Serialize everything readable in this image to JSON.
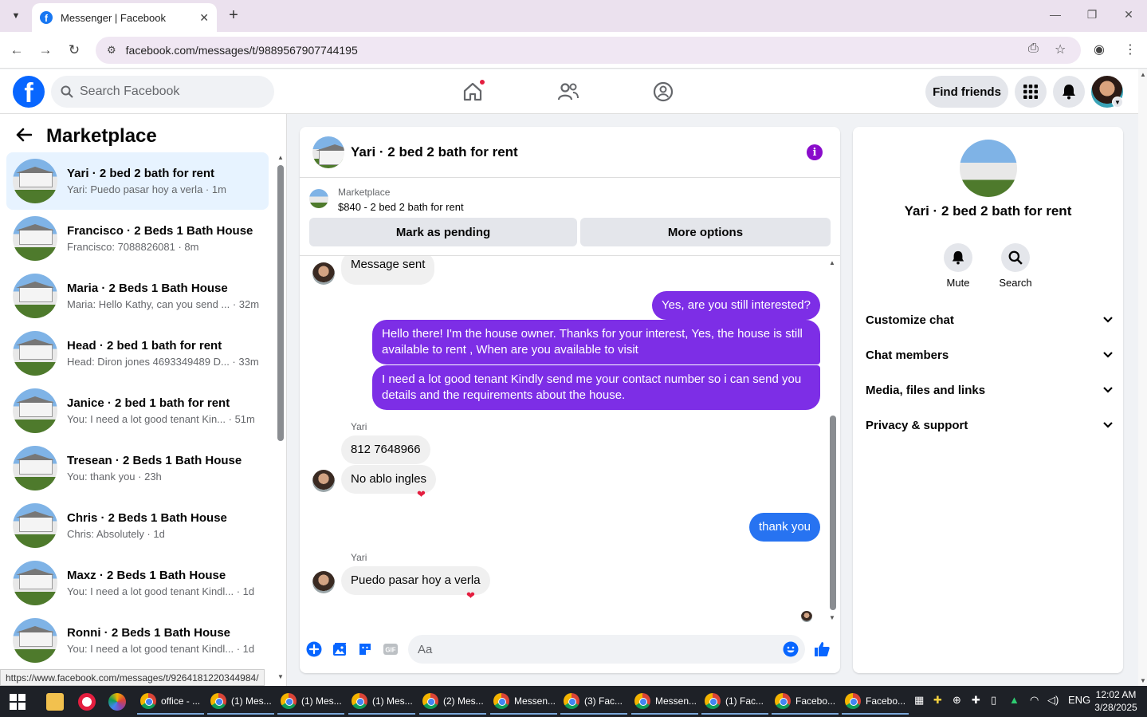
{
  "browser": {
    "tab_title": "Messenger | Facebook",
    "url": "facebook.com/messages/t/9889567907744195",
    "status_url": "https://www.facebook.com/messages/t/9264181220344984/"
  },
  "header": {
    "search_placeholder": "Search Facebook",
    "find_friends": "Find friends"
  },
  "sidebar": {
    "title": "Marketplace",
    "conversations": [
      {
        "name": "Yari · 2 bed 2 bath for rent",
        "preview": "Yari: Puedo pasar hoy a verla · 1m"
      },
      {
        "name": "Francisco · 2 Beds 1 Bath House",
        "preview": "Francisco: 7088826081 · 8m"
      },
      {
        "name": "Maria · 2 Beds 1 Bath House",
        "preview": "Maria: Hello Kathy, can you send ... · 32m"
      },
      {
        "name": "Head · 2 bed 1 bath for rent",
        "preview": "Head: Diron jones 4693349489 D... · 33m"
      },
      {
        "name": "Janice · 2 bed 1 bath for rent",
        "preview": "You: I need a lot good tenant Kin... · 51m"
      },
      {
        "name": "Tresean · 2 Beds 1 Bath House",
        "preview": "You: thank you · 23h"
      },
      {
        "name": "Chris · 2 Beds 1 Bath House",
        "preview": "Chris: Absolutely · 1d"
      },
      {
        "name": "Maxz · 2 Beds 1 Bath House",
        "preview": "You: I need a lot good tenant Kindl... · 1d"
      },
      {
        "name": "Ronni · 2 Beds 1 Bath House",
        "preview": "You: I need a lot good tenant Kindl... · 1d"
      }
    ]
  },
  "chat": {
    "title": "Yari · 2 bed 2 bath for rent",
    "marketplace_label": "Marketplace",
    "listing": "$840 - 2 bed 2 bath for rent",
    "mark_pending": "Mark as pending",
    "more_options": "More options",
    "messages": {
      "m1": "Message sent",
      "m2": "Yes, are you still interested?",
      "m3": "Hello there! I'm the house owner. Thanks for your interest, Yes, the house is still available to rent , When are you available to visit",
      "m4": "I need a lot good tenant Kindly send me your contact number so i can send you details and the requirements about the house.",
      "sender1": "Yari",
      "m5": "812 7648966",
      "m6": "No ablo ingles",
      "m7": "thank you",
      "sender2": "Yari",
      "m8": "Puedo pasar hoy a verla"
    },
    "composer_placeholder": "Aa"
  },
  "info_panel": {
    "name": "Yari · 2 bed 2 bath for rent",
    "mute": "Mute",
    "search": "Search",
    "sections": [
      "Customize chat",
      "Chat members",
      "Media, files and links",
      "Privacy & support"
    ]
  },
  "taskbar": {
    "items": [
      "office - ...",
      "(1) Mes...",
      "(1) Mes...",
      "(1) Mes...",
      "(2) Mes...",
      "Messen...",
      "(3) Fac...",
      "Messen...",
      "(1) Fac...",
      "Facebo...",
      "Facebo..."
    ],
    "lang": "ENG",
    "time": "12:02 AM",
    "date": "3/28/2025"
  },
  "colors": {
    "fb_blue": "#0866ff",
    "messenger_purple": "#7d2ee6",
    "messenger_blue": "#2773f1",
    "active_conv_bg": "#e7f3ff"
  }
}
